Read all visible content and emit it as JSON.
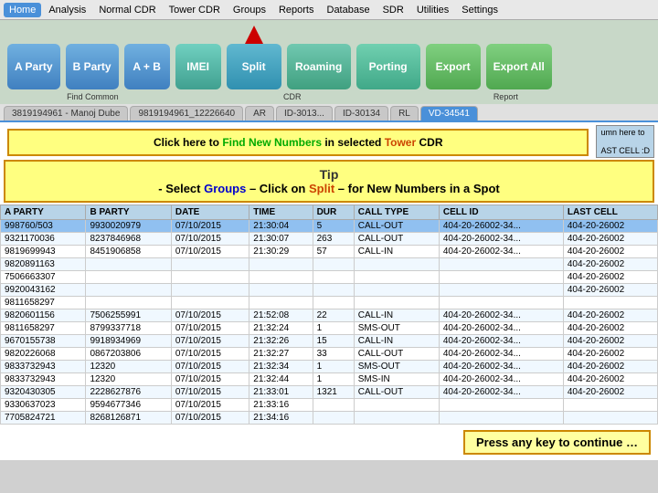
{
  "menu": {
    "items": [
      {
        "label": "Home",
        "active": true
      },
      {
        "label": "Analysis",
        "active": false
      },
      {
        "label": "Normal CDR",
        "active": false
      },
      {
        "label": "Tower CDR",
        "active": false
      },
      {
        "label": "Groups",
        "active": false
      },
      {
        "label": "Reports",
        "active": false
      },
      {
        "label": "Database",
        "active": false
      },
      {
        "label": "SDR",
        "active": false
      },
      {
        "label": "Utilities",
        "active": false
      },
      {
        "label": "Settings",
        "active": false
      }
    ]
  },
  "buttons": [
    {
      "label": "A Party",
      "style": "btn-blue"
    },
    {
      "label": "B Party",
      "style": "btn-blue"
    },
    {
      "label": "A + B",
      "style": "btn-blue"
    },
    {
      "label": "IMEI",
      "style": "btn-teal"
    },
    {
      "label": "Split",
      "style": "btn-split"
    },
    {
      "label": "Roaming",
      "style": "btn-roaming"
    },
    {
      "label": "Porting",
      "style": "btn-porting"
    },
    {
      "label": "Export",
      "style": "btn-export"
    },
    {
      "label": "Export All",
      "style": "btn-exportall"
    }
  ],
  "labels": {
    "find_common": "Find Common",
    "cdr": "CDR",
    "report": "Report"
  },
  "tabs": [
    {
      "label": "3819194961 - Manoj Dube",
      "active": false
    },
    {
      "label": "9819194961_12226640",
      "active": false
    },
    {
      "label": "AR",
      "active": false
    },
    {
      "label": "ID-3013...",
      "active": false
    },
    {
      "label": "ID-30134",
      "active": false
    },
    {
      "label": "RL",
      "active": false
    },
    {
      "label": "VD-34541",
      "active": true
    }
  ],
  "tooltip": {
    "text1": "Click here to ",
    "find": "Find New Numbers",
    "text2": " in selected ",
    "tower": "Tower",
    "text3": " CDR",
    "column_hint": "umn here to",
    "last_cell": "AST CELL :D"
  },
  "tip": {
    "title": "Tip",
    "text_before": "- Select ",
    "groups": "Groups",
    "text_mid": " – Click on ",
    "split": "Split",
    "text_after": " – for New Numbers in a Spot"
  },
  "press_key": "Press any key to continue …",
  "table": {
    "headers": [
      "A PARTY",
      "B PARTY",
      "DATE",
      "TIME",
      "DURATION",
      "CALL TYPE",
      "CELL ID",
      "LAST CELL"
    ],
    "rows": [
      [
        "998760/503",
        "9930020979",
        "07/10/2015",
        "21:30:04",
        "5",
        "CALL-OUT",
        "404-20-26002-34...",
        "404-20-26002"
      ],
      [
        "9321170036",
        "8237846968",
        "07/10/2015",
        "21:30:07",
        "263",
        "CALL-OUT",
        "404-20-26002-34...",
        "404-20-26002"
      ],
      [
        "9819699943",
        "8451906858",
        "07/10/2015",
        "21:30:29",
        "57",
        "CALL-IN",
        "404-20-26002-34...",
        "404-20-26002"
      ],
      [
        "9820891163",
        "",
        "",
        "",
        "",
        "",
        "",
        "404-20-26002"
      ],
      [
        "7506663307",
        "",
        "",
        "",
        "",
        "",
        "",
        "404-20-26002"
      ],
      [
        "9920043162",
        "",
        "",
        "",
        "",
        "",
        "",
        "404-20-26002"
      ],
      [
        "9811658297",
        "",
        "",
        "",
        "",
        "",
        "",
        ""
      ],
      [
        "9820601156",
        "7506255991",
        "07/10/2015",
        "21:52:08",
        "22",
        "CALL-IN",
        "404-20-26002-34...",
        "404-20-26002"
      ],
      [
        "9811658297",
        "8799337718",
        "07/10/2015",
        "21:32:24",
        "1",
        "SMS-OUT",
        "404-20-26002-34...",
        "404-20-26002"
      ],
      [
        "9670155738",
        "9918934969",
        "07/10/2015",
        "21:32:26",
        "15",
        "CALL-IN",
        "404-20-26002-34...",
        "404-20-26002"
      ],
      [
        "9820226068",
        "0867203806",
        "07/10/2015",
        "21:32:27",
        "33",
        "CALL-OUT",
        "404-20-26002-34...",
        "404-20-26002"
      ],
      [
        "9833732943",
        "12320",
        "07/10/2015",
        "21:32:34",
        "1",
        "SMS-OUT",
        "404-20-26002-34...",
        "404-20-26002"
      ],
      [
        "9833732943",
        "12320",
        "07/10/2015",
        "21:32:44",
        "1",
        "SMS-IN",
        "404-20-26002-34...",
        "404-20-26002"
      ],
      [
        "9320430305",
        "2228627876",
        "07/10/2015",
        "21:33:01",
        "1321",
        "CALL-OUT",
        "404-20-26002-34...",
        "404-20-26002"
      ],
      [
        "9330637023",
        "9594677346",
        "07/10/2015",
        "21:33:16",
        "",
        "",
        "",
        ""
      ],
      [
        "7705824721",
        "8268126871",
        "07/10/2015",
        "21:34:16",
        "",
        "",
        "",
        ""
      ]
    ]
  }
}
